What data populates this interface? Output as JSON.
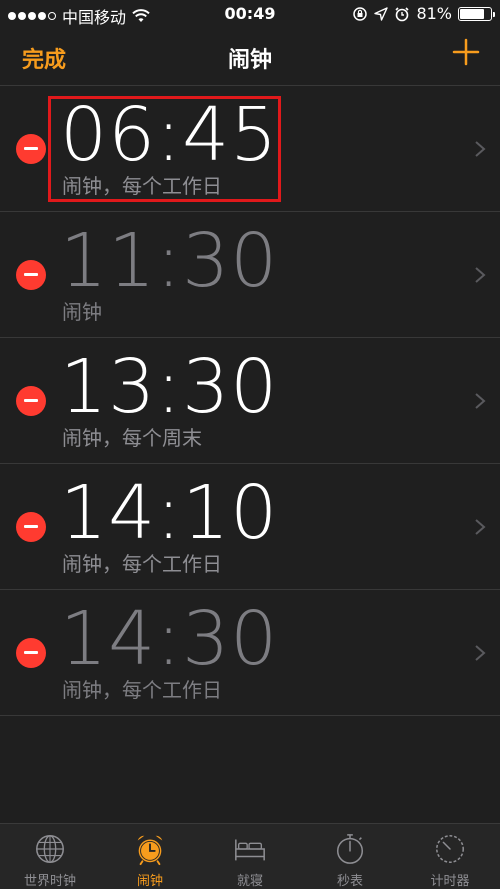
{
  "status_bar": {
    "carrier": "中国移动",
    "time": "00:49",
    "battery_percent": "81%",
    "battery_level": 0.81,
    "signal_bars_filled": 4,
    "signal_bars_total": 5
  },
  "nav": {
    "done_label": "完成",
    "title": "闹钟",
    "add_label": "+"
  },
  "colors": {
    "accent": "#f79c1d",
    "delete": "#ff3b30",
    "highlight": "#e0191b"
  },
  "alarms": [
    {
      "time": "06:45",
      "label": "闹钟，每个工作日",
      "enabled": true
    },
    {
      "time": "11:30",
      "label": "闹钟",
      "enabled": false
    },
    {
      "time": "13:30",
      "label": "闹钟，每个周末",
      "enabled": true
    },
    {
      "time": "14:10",
      "label": "闹钟，每个工作日",
      "enabled": true
    },
    {
      "time": "14:30",
      "label": "闹钟，每个工作日",
      "enabled": false
    }
  ],
  "tabs": [
    {
      "label": "世界时钟",
      "icon": "globe-icon",
      "active": false
    },
    {
      "label": "闹钟",
      "icon": "alarm-clock-icon",
      "active": true
    },
    {
      "label": "就寝",
      "icon": "bed-icon",
      "active": false
    },
    {
      "label": "秒表",
      "icon": "stopwatch-icon",
      "active": false
    },
    {
      "label": "计时器",
      "icon": "timer-icon",
      "active": false
    }
  ]
}
